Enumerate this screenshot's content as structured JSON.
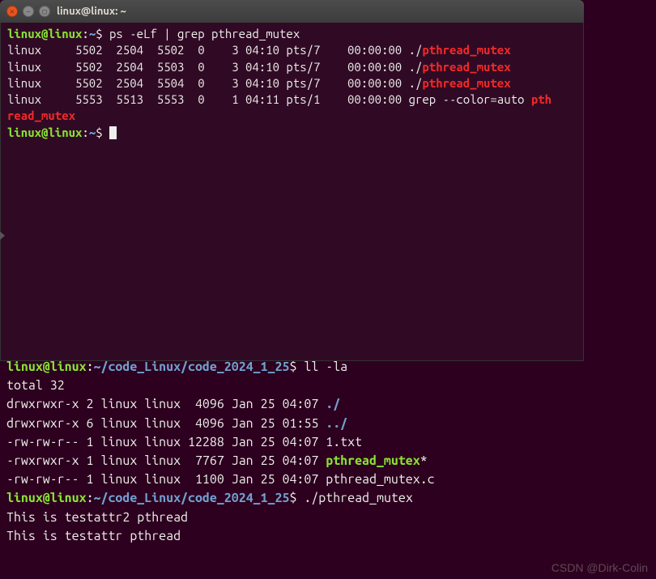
{
  "window": {
    "title": "linux@linux: ~"
  },
  "top_terminal": {
    "prompt1": {
      "user": "linux@linux",
      "colon": ":",
      "path": "~",
      "dollar": "$",
      "cmd": " ps -eLf | grep pthread_mutex"
    },
    "rows": [
      {
        "user": "linux",
        "pid": "5502",
        "ppid": "2504",
        "lwp": "5502",
        "c": "0",
        "nlwp": "3",
        "stime": "04:10",
        "tty": "pts/7",
        "time": "00:00:00",
        "cmd_pre": "./",
        "cmd_hl": "pthread_mutex"
      },
      {
        "user": "linux",
        "pid": "5502",
        "ppid": "2504",
        "lwp": "5503",
        "c": "0",
        "nlwp": "3",
        "stime": "04:10",
        "tty": "pts/7",
        "time": "00:00:00",
        "cmd_pre": "./",
        "cmd_hl": "pthread_mutex"
      },
      {
        "user": "linux",
        "pid": "5502",
        "ppid": "2504",
        "lwp": "5504",
        "c": "0",
        "nlwp": "3",
        "stime": "04:10",
        "tty": "pts/7",
        "time": "00:00:00",
        "cmd_pre": "./",
        "cmd_hl": "pthread_mutex"
      },
      {
        "user": "linux",
        "pid": "5553",
        "ppid": "5513",
        "lwp": "5553",
        "c": "0",
        "nlwp": "1",
        "stime": "04:11",
        "tty": "pts/1",
        "time": "00:00:00",
        "cmd_pre": "grep --color=auto ",
        "cmd_hl": "pthread_mutex"
      }
    ],
    "prompt2": {
      "user": "linux@linux",
      "colon": ":",
      "path": "~",
      "dollar": "$"
    }
  },
  "bg_terminal": {
    "prompt1": {
      "user": "linux@linux",
      "colon": ":",
      "path": "~/code_Linux/code_2024_1_25",
      "dollar": "$",
      "cmd": " ll -la"
    },
    "total": "total 32",
    "rows": [
      {
        "perm": "drwxrwxr-x",
        "n": "2",
        "u": "linux",
        "g": "linux",
        "size": " 4096",
        "date": "Jan 25 04:07",
        "name": "./",
        "cls": "highlight-blue"
      },
      {
        "perm": "drwxrwxr-x",
        "n": "6",
        "u": "linux",
        "g": "linux",
        "size": " 4096",
        "date": "Jan 25 01:55",
        "name": "../",
        "cls": "highlight-blue"
      },
      {
        "perm": "-rw-rw-r--",
        "n": "1",
        "u": "linux",
        "g": "linux",
        "size": "12288",
        "date": "Jan 25 04:07",
        "name": "1.txt",
        "cls": "cmd-text"
      },
      {
        "perm": "-rwxrwxr-x",
        "n": "1",
        "u": "linux",
        "g": "linux",
        "size": " 7767",
        "date": "Jan 25 04:07",
        "name": "pthread_mutex",
        "suffix": "*",
        "cls": "highlight-green"
      },
      {
        "perm": "-rw-rw-r--",
        "n": "1",
        "u": "linux",
        "g": "linux",
        "size": " 1100",
        "date": "Jan 25 04:07",
        "name": "pthread_mutex.c",
        "cls": "cmd-text"
      }
    ],
    "prompt2": {
      "user": "linux@linux",
      "colon": ":",
      "path": "~/code_Linux/code_2024_1_25",
      "dollar": "$",
      "cmd": " ./pthread_mutex"
    },
    "out1": "This is testattr2 pthread",
    "out2": "This is testattr pthread"
  },
  "watermark": "CSDN @Dirk-Colin"
}
